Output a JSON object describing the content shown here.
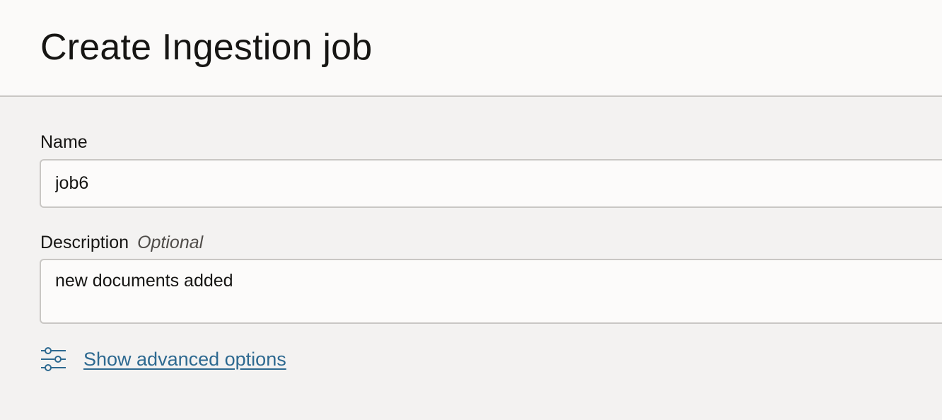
{
  "header": {
    "title": "Create Ingestion job"
  },
  "form": {
    "name": {
      "label": "Name",
      "value": "job6"
    },
    "description": {
      "label": "Description",
      "optional_text": "Optional",
      "value": "new documents added"
    },
    "advanced_options": {
      "icon": "sliders-icon",
      "link_text": "Show advanced options"
    }
  },
  "colors": {
    "header_bg": "#fbfaf9",
    "page_bg": "#f3f2f1",
    "field_border": "#c9c7c4",
    "link": "#2d6990"
  }
}
